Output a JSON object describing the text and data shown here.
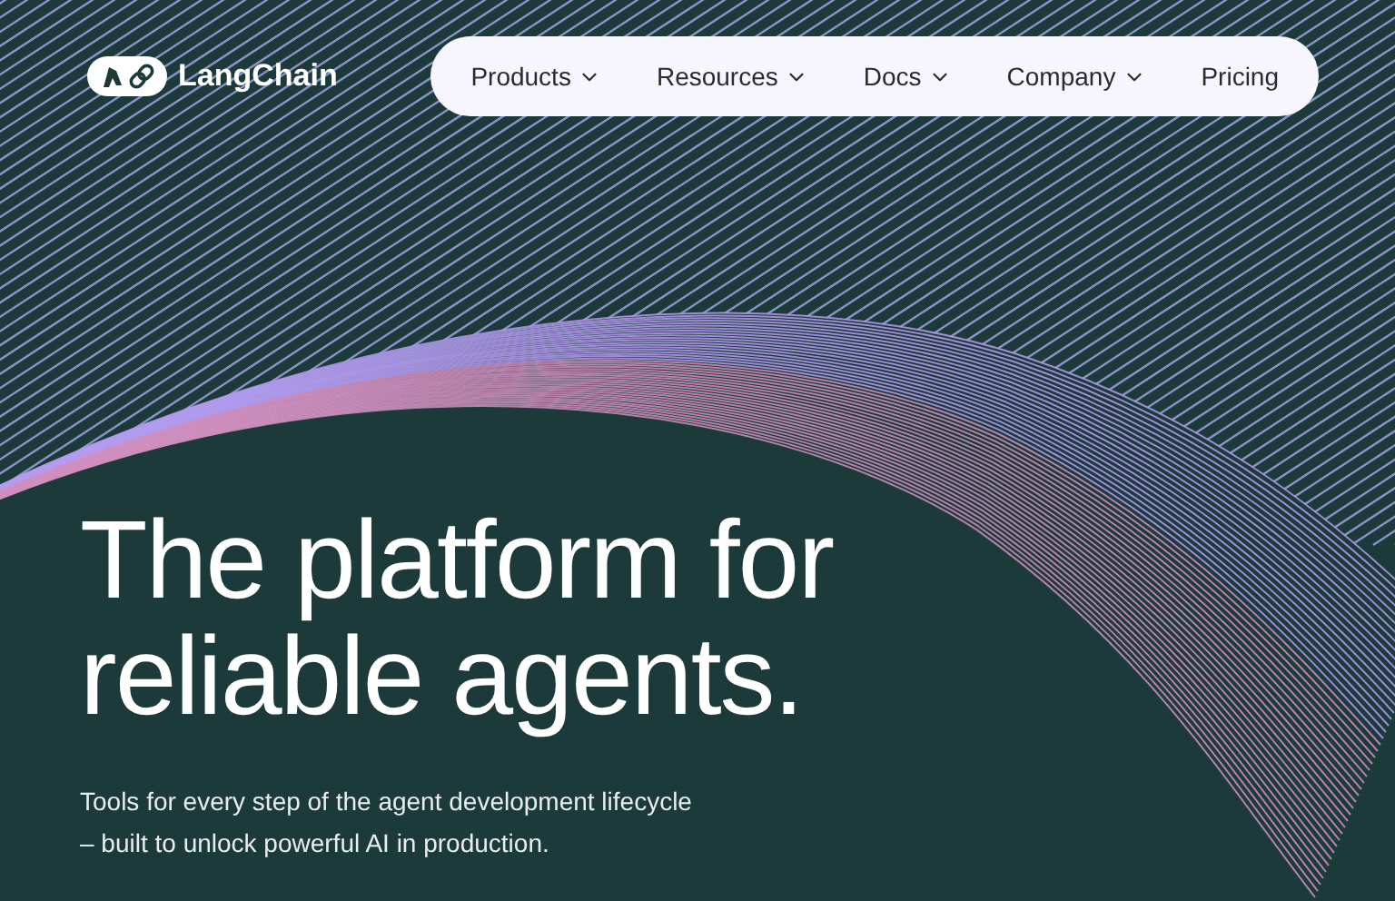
{
  "logo": {
    "text": "LangChain"
  },
  "nav": [
    {
      "label": "Products",
      "dropdown": true
    },
    {
      "label": "Resources",
      "dropdown": true
    },
    {
      "label": "Docs",
      "dropdown": true
    },
    {
      "label": "Company",
      "dropdown": true
    },
    {
      "label": "Pricing",
      "dropdown": false
    }
  ],
  "hero": {
    "headline": [
      "The platform for",
      "reliable agents."
    ],
    "subtitle": [
      "Tools for every step of the agent development lifecycle",
      "– built to unlock powerful AI in production."
    ]
  }
}
